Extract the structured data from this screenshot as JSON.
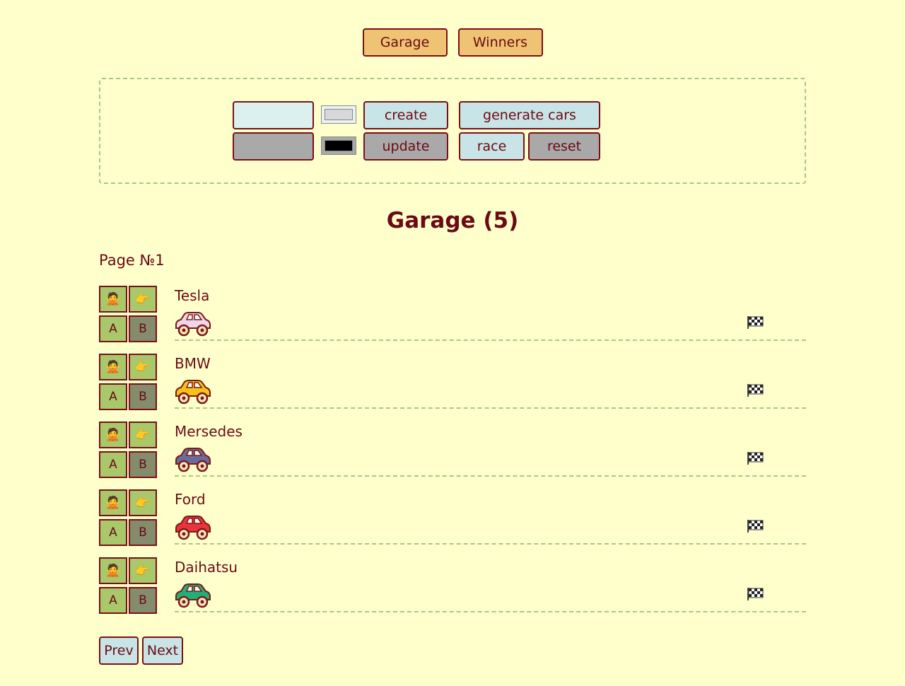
{
  "nav": {
    "garage_label": "Garage",
    "winners_label": "Winners"
  },
  "controls": {
    "create_name_value": "",
    "create_color": "#d8d8d8",
    "create_label": "create",
    "update_name_value": "",
    "update_color": "#000000",
    "update_label": "update",
    "generate_label": "generate cars",
    "race_label": "race",
    "reset_label": "reset"
  },
  "garage": {
    "title": "Garage (5)",
    "page_label": "Page №1",
    "select_icon": "person-gesturing-no-icon",
    "remove_icon": "pointing-hand-icon",
    "start_label": "A",
    "stop_label": "B",
    "cars": [
      {
        "name": "Tesla",
        "color": "#f0d6ec"
      },
      {
        "name": "BMW",
        "color": "#f6c21a"
      },
      {
        "name": "Mersedes",
        "color": "#6c6a9c"
      },
      {
        "name": "Ford",
        "color": "#e8343c"
      },
      {
        "name": "Daihatsu",
        "color": "#1fb07a"
      }
    ]
  },
  "pagination": {
    "prev_label": "Prev",
    "next_label": "Next"
  }
}
